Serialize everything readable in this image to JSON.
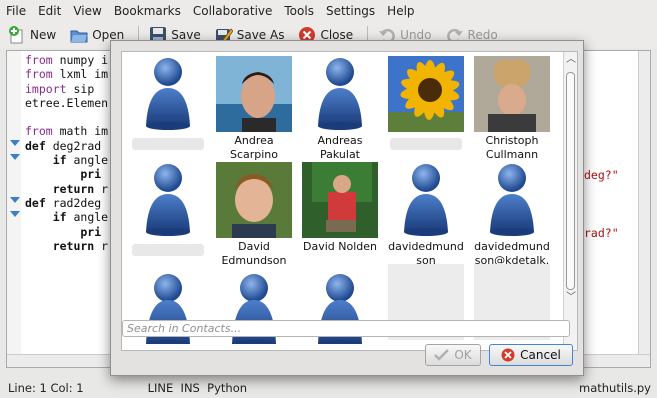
{
  "menubar": {
    "items": [
      "File",
      "Edit",
      "View",
      "Bookmarks",
      "Collaborative",
      "Tools",
      "Settings",
      "Help"
    ]
  },
  "toolbar": {
    "new_label": "New",
    "open_label": "Open",
    "save_label": "Save",
    "save_as_label": "Save As",
    "close_label": "Close",
    "undo_label": "Undo",
    "redo_label": "Redo"
  },
  "editor": {
    "lines": [
      [
        "from",
        " numpy i"
      ],
      [
        "from",
        " lxml im"
      ],
      [
        "import",
        " sip"
      ],
      [
        "",
        "etree.Elemen"
      ],
      [
        "",
        ""
      ],
      [
        "from",
        " math im"
      ],
      [
        "def",
        " deg2rad"
      ],
      [
        "    if",
        " angle"
      ],
      [
        "        pri",
        ""
      ],
      [
        "    return",
        " r"
      ],
      [
        "def",
        " rad2deg"
      ],
      [
        "    if",
        " angle"
      ],
      [
        "        pri",
        ""
      ],
      [
        "    return",
        " r"
      ]
    ],
    "string_fragments": [
      "deg?\"",
      "rad?\""
    ]
  },
  "statusbar": {
    "position": "Line: 1 Col: 1",
    "mode": "LINE  INS  Python",
    "filename": "mathutils.py"
  },
  "dialog": {
    "contacts": [
      {
        "name": "",
        "type": "generic",
        "blurred": true
      },
      {
        "name": "Andrea\nScarpino",
        "type": "photo-andrea"
      },
      {
        "name": "Andreas\nPakulat",
        "type": "generic"
      },
      {
        "name": "",
        "type": "photo-sunflower",
        "blurred": true
      },
      {
        "name": "Christoph\nCullmann",
        "type": "photo-christoph"
      },
      {
        "name": "",
        "type": "generic",
        "blurred": true
      },
      {
        "name": "David\nEdmundson",
        "type": "photo-david"
      },
      {
        "name": "David Nolden",
        "type": "photo-nolden"
      },
      {
        "name": "davidedmund\nson",
        "type": "generic"
      },
      {
        "name": "davidedmund\nson@kdetalk.",
        "type": "generic"
      },
      {
        "name": "",
        "type": "generic-partial"
      },
      {
        "name": "",
        "type": "generic-partial"
      },
      {
        "name": "",
        "type": "generic-partial"
      },
      {
        "name": "",
        "type": "blurred-photo"
      },
      {
        "name": "",
        "type": "blurred-photo"
      }
    ],
    "search_placeholder": "Search in Contacts...",
    "ok_label": "OK",
    "cancel_label": "Cancel"
  },
  "colors": {
    "accent": "#3f86d6",
    "keyword_purple": "#8b2a8b",
    "string_red": "#b01010",
    "person_icon_blue": "#2d5da8"
  }
}
